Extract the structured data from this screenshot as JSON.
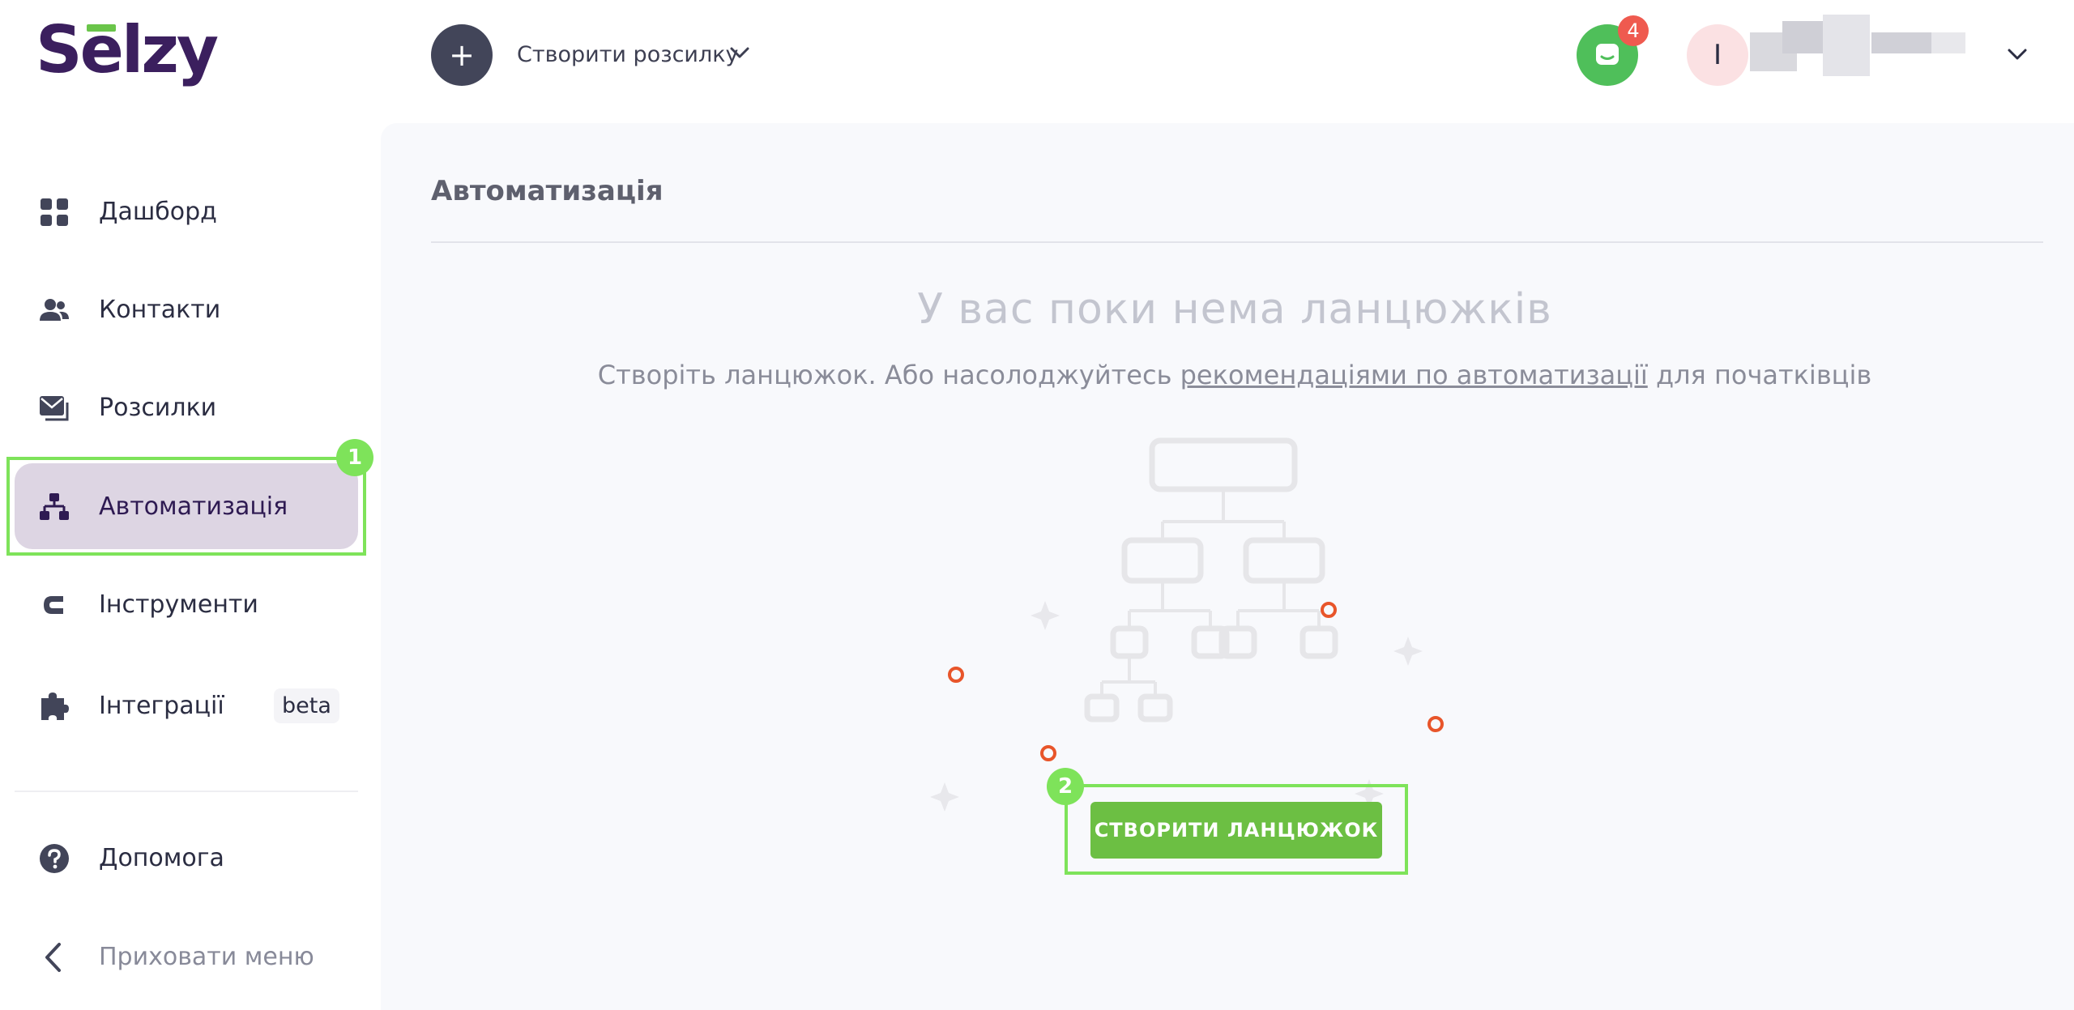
{
  "logo": {
    "text_s": "S",
    "text_e": "e",
    "text_rest": "lzy"
  },
  "header": {
    "create_label": "Створити розсилку",
    "chat_badge": "4",
    "avatar_letter": "I"
  },
  "sidebar": {
    "items": [
      {
        "label": "Дашборд",
        "icon": "dashboard-icon"
      },
      {
        "label": "Контакти",
        "icon": "contacts-icon"
      },
      {
        "label": "Розсилки",
        "icon": "mail-icon"
      },
      {
        "label": "Автоматизація",
        "icon": "automation-icon",
        "active": true
      },
      {
        "label": "Інструменти",
        "icon": "tools-icon"
      },
      {
        "label": "Інтеграції",
        "icon": "puzzle-icon",
        "badge": "beta"
      },
      {
        "label": "Допомога",
        "icon": "help-icon"
      },
      {
        "label": "Приховати меню",
        "icon": "chevron-left-icon"
      }
    ]
  },
  "annotations": {
    "first": "1",
    "second": "2"
  },
  "main": {
    "title": "Автоматизація",
    "empty_title": "У вас поки нема ланцюжків",
    "empty_sub_before": "Створіть ланцюжок. Або насолоджуйтесь ",
    "empty_sub_link": "рекомендаціями по автоматизації",
    "empty_sub_after": " для початківців",
    "cta_label": "СТВОРИТИ ЛАНЦЮЖОК"
  },
  "colors": {
    "brand": "#3b1f5e",
    "accent_green": "#6cbf43",
    "highlight": "#7ee35a",
    "badge_red": "#ef5a4f",
    "dot_orange": "#e8552a"
  }
}
